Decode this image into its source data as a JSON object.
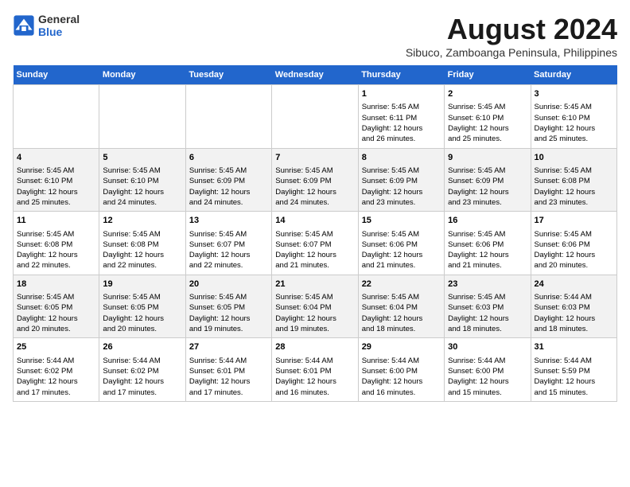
{
  "logo": {
    "line1": "General",
    "line2": "Blue"
  },
  "title": "August 2024",
  "subtitle": "Sibuco, Zamboanga Peninsula, Philippines",
  "headers": [
    "Sunday",
    "Monday",
    "Tuesday",
    "Wednesday",
    "Thursday",
    "Friday",
    "Saturday"
  ],
  "weeks": [
    [
      {
        "day": "",
        "info": ""
      },
      {
        "day": "",
        "info": ""
      },
      {
        "day": "",
        "info": ""
      },
      {
        "day": "",
        "info": ""
      },
      {
        "day": "1",
        "info": "Sunrise: 5:45 AM\nSunset: 6:11 PM\nDaylight: 12 hours\nand 26 minutes."
      },
      {
        "day": "2",
        "info": "Sunrise: 5:45 AM\nSunset: 6:10 PM\nDaylight: 12 hours\nand 25 minutes."
      },
      {
        "day": "3",
        "info": "Sunrise: 5:45 AM\nSunset: 6:10 PM\nDaylight: 12 hours\nand 25 minutes."
      }
    ],
    [
      {
        "day": "4",
        "info": "Sunrise: 5:45 AM\nSunset: 6:10 PM\nDaylight: 12 hours\nand 25 minutes."
      },
      {
        "day": "5",
        "info": "Sunrise: 5:45 AM\nSunset: 6:10 PM\nDaylight: 12 hours\nand 24 minutes."
      },
      {
        "day": "6",
        "info": "Sunrise: 5:45 AM\nSunset: 6:09 PM\nDaylight: 12 hours\nand 24 minutes."
      },
      {
        "day": "7",
        "info": "Sunrise: 5:45 AM\nSunset: 6:09 PM\nDaylight: 12 hours\nand 24 minutes."
      },
      {
        "day": "8",
        "info": "Sunrise: 5:45 AM\nSunset: 6:09 PM\nDaylight: 12 hours\nand 23 minutes."
      },
      {
        "day": "9",
        "info": "Sunrise: 5:45 AM\nSunset: 6:09 PM\nDaylight: 12 hours\nand 23 minutes."
      },
      {
        "day": "10",
        "info": "Sunrise: 5:45 AM\nSunset: 6:08 PM\nDaylight: 12 hours\nand 23 minutes."
      }
    ],
    [
      {
        "day": "11",
        "info": "Sunrise: 5:45 AM\nSunset: 6:08 PM\nDaylight: 12 hours\nand 22 minutes."
      },
      {
        "day": "12",
        "info": "Sunrise: 5:45 AM\nSunset: 6:08 PM\nDaylight: 12 hours\nand 22 minutes."
      },
      {
        "day": "13",
        "info": "Sunrise: 5:45 AM\nSunset: 6:07 PM\nDaylight: 12 hours\nand 22 minutes."
      },
      {
        "day": "14",
        "info": "Sunrise: 5:45 AM\nSunset: 6:07 PM\nDaylight: 12 hours\nand 21 minutes."
      },
      {
        "day": "15",
        "info": "Sunrise: 5:45 AM\nSunset: 6:06 PM\nDaylight: 12 hours\nand 21 minutes."
      },
      {
        "day": "16",
        "info": "Sunrise: 5:45 AM\nSunset: 6:06 PM\nDaylight: 12 hours\nand 21 minutes."
      },
      {
        "day": "17",
        "info": "Sunrise: 5:45 AM\nSunset: 6:06 PM\nDaylight: 12 hours\nand 20 minutes."
      }
    ],
    [
      {
        "day": "18",
        "info": "Sunrise: 5:45 AM\nSunset: 6:05 PM\nDaylight: 12 hours\nand 20 minutes."
      },
      {
        "day": "19",
        "info": "Sunrise: 5:45 AM\nSunset: 6:05 PM\nDaylight: 12 hours\nand 20 minutes."
      },
      {
        "day": "20",
        "info": "Sunrise: 5:45 AM\nSunset: 6:05 PM\nDaylight: 12 hours\nand 19 minutes."
      },
      {
        "day": "21",
        "info": "Sunrise: 5:45 AM\nSunset: 6:04 PM\nDaylight: 12 hours\nand 19 minutes."
      },
      {
        "day": "22",
        "info": "Sunrise: 5:45 AM\nSunset: 6:04 PM\nDaylight: 12 hours\nand 18 minutes."
      },
      {
        "day": "23",
        "info": "Sunrise: 5:45 AM\nSunset: 6:03 PM\nDaylight: 12 hours\nand 18 minutes."
      },
      {
        "day": "24",
        "info": "Sunrise: 5:44 AM\nSunset: 6:03 PM\nDaylight: 12 hours\nand 18 minutes."
      }
    ],
    [
      {
        "day": "25",
        "info": "Sunrise: 5:44 AM\nSunset: 6:02 PM\nDaylight: 12 hours\nand 17 minutes."
      },
      {
        "day": "26",
        "info": "Sunrise: 5:44 AM\nSunset: 6:02 PM\nDaylight: 12 hours\nand 17 minutes."
      },
      {
        "day": "27",
        "info": "Sunrise: 5:44 AM\nSunset: 6:01 PM\nDaylight: 12 hours\nand 17 minutes."
      },
      {
        "day": "28",
        "info": "Sunrise: 5:44 AM\nSunset: 6:01 PM\nDaylight: 12 hours\nand 16 minutes."
      },
      {
        "day": "29",
        "info": "Sunrise: 5:44 AM\nSunset: 6:00 PM\nDaylight: 12 hours\nand 16 minutes."
      },
      {
        "day": "30",
        "info": "Sunrise: 5:44 AM\nSunset: 6:00 PM\nDaylight: 12 hours\nand 15 minutes."
      },
      {
        "day": "31",
        "info": "Sunrise: 5:44 AM\nSunset: 5:59 PM\nDaylight: 12 hours\nand 15 minutes."
      }
    ]
  ]
}
